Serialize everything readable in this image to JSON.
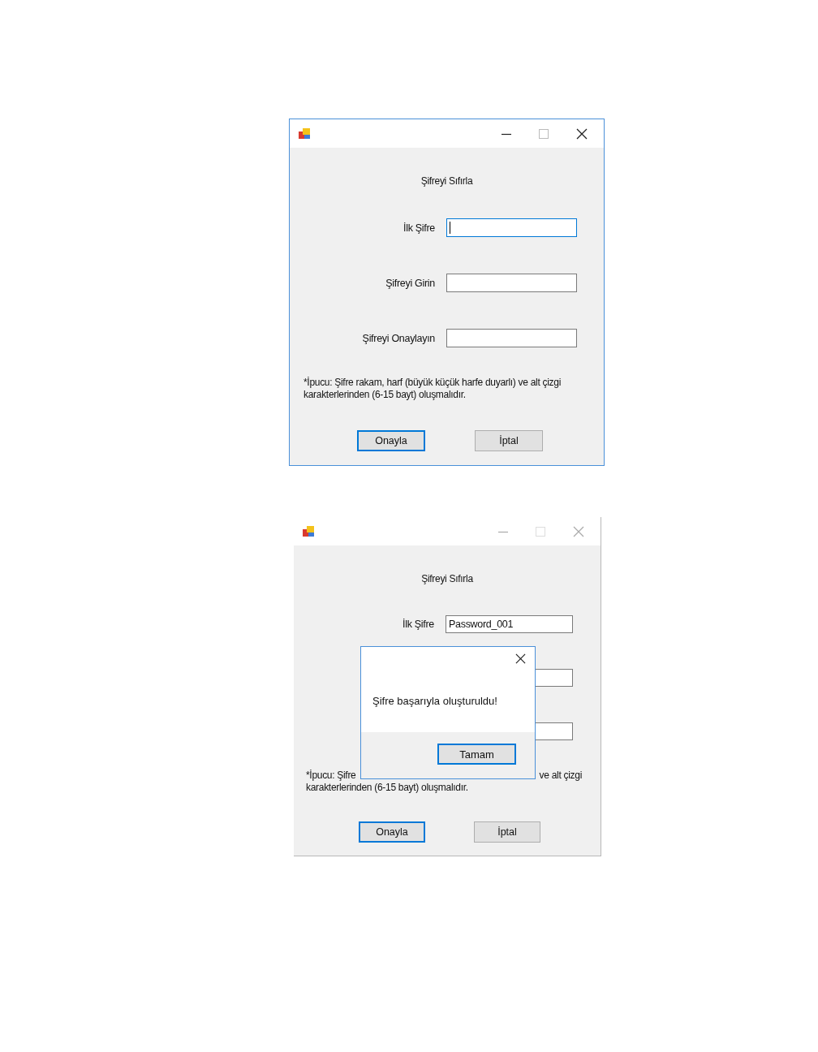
{
  "windows": [
    {
      "active": true,
      "heading": "Şifreyi Sıfırla",
      "fields": [
        {
          "label": "İlk Şifre",
          "focused": true
        },
        {
          "label": "Şifreyi Girin",
          "focused": false
        },
        {
          "label": "Şifreyi Onaylayın",
          "focused": false
        }
      ],
      "hint_lines": [
        [
          "*İpucu: Şifre rakam, harf (büyük küçük harfe duyarlı) ve alt çizgi"
        ],
        [
          "karakterlerinden (6-15 bayt) oluşmalıdır."
        ]
      ],
      "buttons": [
        {
          "label": "Onayla",
          "default": true
        },
        {
          "label": "İptal",
          "default": false
        }
      ]
    },
    {
      "active": false,
      "heading": "Şifreyi Sıfırla",
      "fields": [
        {
          "label": "İlk Şifre",
          "value": "Password_001",
          "focused": false
        },
        {
          "focused": false
        },
        {
          "focused": false
        }
      ],
      "hint_lines": [
        [
          "*İpucu: Şifre",
          "ve alt çizgi"
        ],
        [
          "karakterlerinden (6-15 bayt) oluşmalıdır."
        ]
      ],
      "buttons": [
        {
          "label": "Onayla",
          "default": true
        },
        {
          "label": "İptal",
          "default": false
        }
      ],
      "message_box": {
        "message": "Şifre başarıyla oluşturuldu!",
        "buttons": [
          {
            "label": "Tamam",
            "default": true
          }
        ]
      }
    }
  ]
}
